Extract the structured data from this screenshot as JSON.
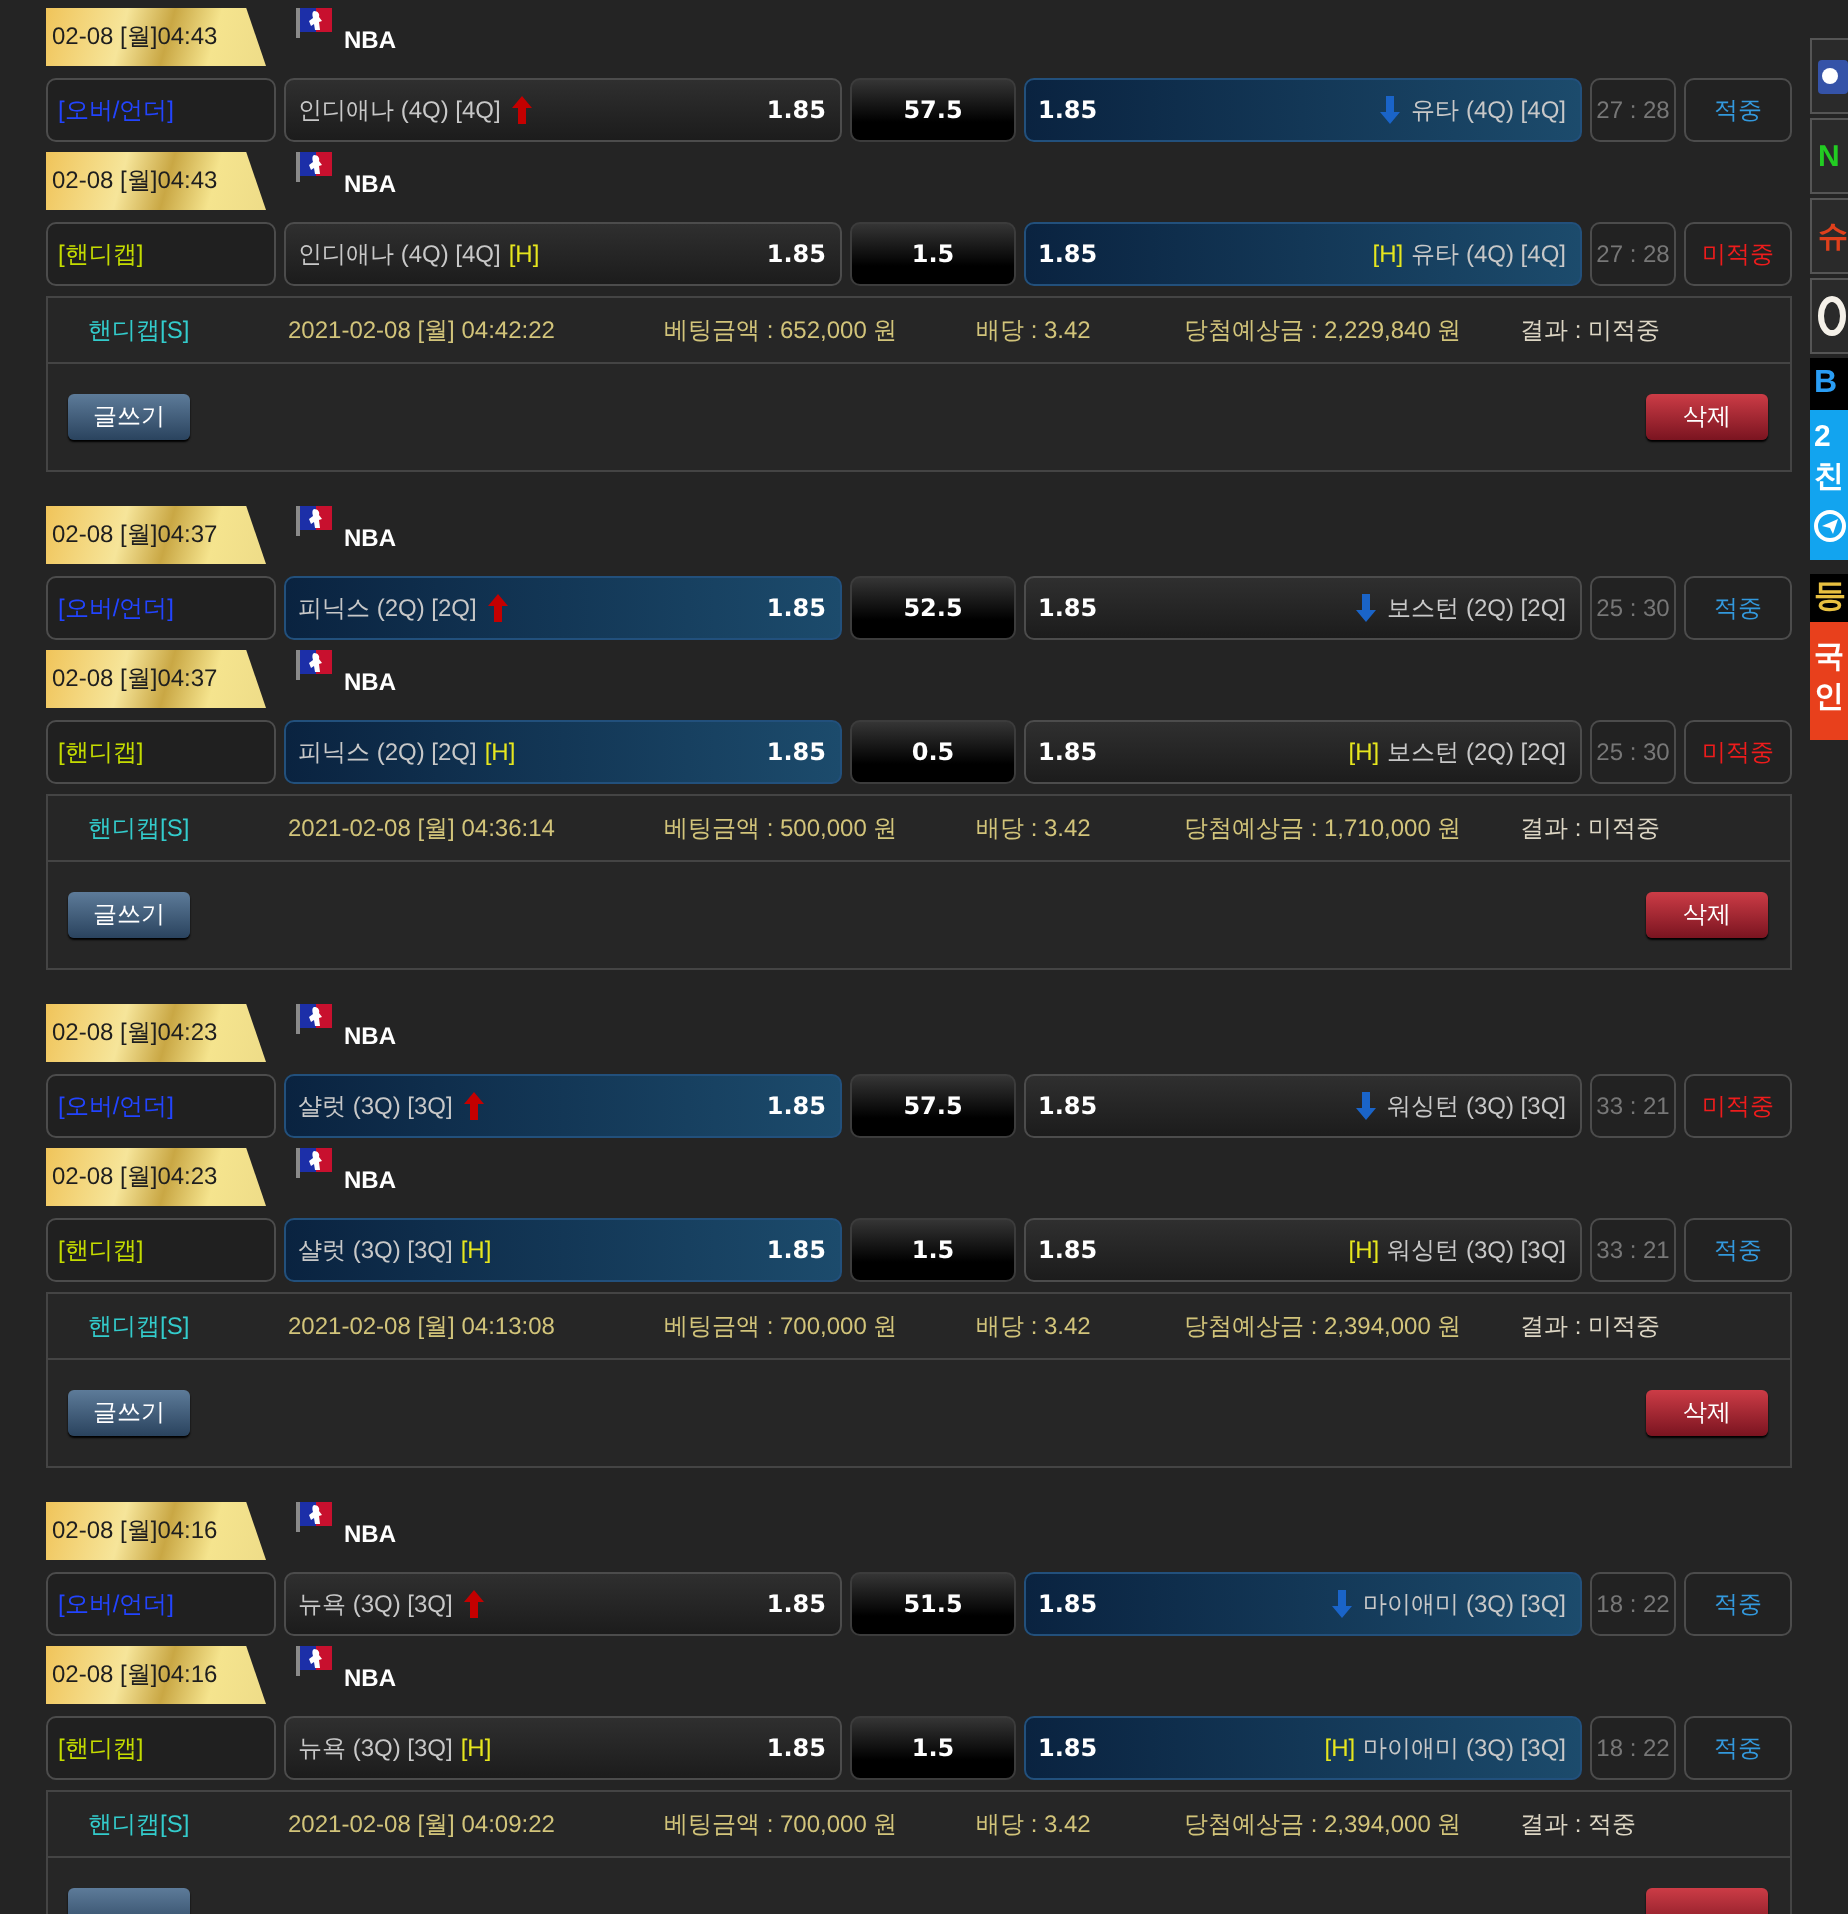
{
  "bets": [
    {
      "slips": [
        {
          "date": "02-08 [월]04:43",
          "league": "NBA",
          "kind": "over_under",
          "type_label": "[오버/언더]",
          "home": {
            "name": "인디애나 (4Q) [4Q]",
            "odds": "1.85",
            "selected": false
          },
          "line": "57.5",
          "away": {
            "name": "유타 (4Q) [4Q]",
            "odds": "1.85",
            "selected": true
          },
          "score": "27 : 28",
          "result": "적중",
          "hit": true
        },
        {
          "date": "02-08 [월]04:43",
          "league": "NBA",
          "kind": "handicap",
          "type_label": "[핸디캡]",
          "home": {
            "name": "인디애나 (4Q) [4Q]",
            "tag": "[H]",
            "odds": "1.85",
            "selected": false
          },
          "line": "1.5",
          "away": {
            "name": "유타 (4Q) [4Q]",
            "tag": "[H]",
            "odds": "1.85",
            "selected": true
          },
          "score": "27 : 28",
          "result": "미적중",
          "hit": false
        }
      ],
      "summary": {
        "type": "핸디캡[S]",
        "time": "2021-02-08 [월] 04:42:22",
        "amount": "베팅금액 : 652,000 원",
        "odds": "배당 : 3.42",
        "payout": "당첨예상금 : 2,229,840 원",
        "result": "결과 : 미적중"
      },
      "buttons": [
        {
          "kind": "write",
          "label": "글쓰기"
        },
        {
          "kind": "delete",
          "label": "삭제"
        }
      ]
    },
    {
      "slips": [
        {
          "date": "02-08 [월]04:37",
          "league": "NBA",
          "kind": "over_under",
          "type_label": "[오버/언더]",
          "home": {
            "name": "피닉스 (2Q) [2Q]",
            "odds": "1.85",
            "selected": true
          },
          "line": "52.5",
          "away": {
            "name": "보스턴 (2Q) [2Q]",
            "odds": "1.85",
            "selected": false
          },
          "score": "25 : 30",
          "result": "적중",
          "hit": true
        },
        {
          "date": "02-08 [월]04:37",
          "league": "NBA",
          "kind": "handicap",
          "type_label": "[핸디캡]",
          "home": {
            "name": "피닉스 (2Q) [2Q]",
            "tag": "[H]",
            "odds": "1.85",
            "selected": true
          },
          "line": "0.5",
          "away": {
            "name": "보스턴 (2Q) [2Q]",
            "tag": "[H]",
            "odds": "1.85",
            "selected": false
          },
          "score": "25 : 30",
          "result": "미적중",
          "hit": false
        }
      ],
      "summary": {
        "type": "핸디캡[S]",
        "time": "2021-02-08 [월] 04:36:14",
        "amount": "베팅금액 : 500,000 원",
        "odds": "배당 : 3.42",
        "payout": "당첨예상금 : 1,710,000 원",
        "result": "결과 : 미적중"
      },
      "buttons": [
        {
          "kind": "write",
          "label": "글쓰기"
        },
        {
          "kind": "delete",
          "label": "삭제"
        }
      ]
    },
    {
      "slips": [
        {
          "date": "02-08 [월]04:23",
          "league": "NBA",
          "kind": "over_under",
          "type_label": "[오버/언더]",
          "home": {
            "name": "샬럿 (3Q) [3Q]",
            "odds": "1.85",
            "selected": true
          },
          "line": "57.5",
          "away": {
            "name": "워싱턴 (3Q) [3Q]",
            "odds": "1.85",
            "selected": false
          },
          "score": "33 : 21",
          "result": "미적중",
          "hit": false
        },
        {
          "date": "02-08 [월]04:23",
          "league": "NBA",
          "kind": "handicap",
          "type_label": "[핸디캡]",
          "home": {
            "name": "샬럿 (3Q) [3Q]",
            "tag": "[H]",
            "odds": "1.85",
            "selected": true
          },
          "line": "1.5",
          "away": {
            "name": "워싱턴 (3Q) [3Q]",
            "tag": "[H]",
            "odds": "1.85",
            "selected": false
          },
          "score": "33 : 21",
          "result": "적중",
          "hit": true
        }
      ],
      "summary": {
        "type": "핸디캡[S]",
        "time": "2021-02-08 [월] 04:13:08",
        "amount": "베팅금액 : 700,000 원",
        "odds": "배당 : 3.42",
        "payout": "당첨예상금 : 2,394,000 원",
        "result": "결과 : 미적중"
      },
      "buttons": [
        {
          "kind": "write",
          "label": "글쓰기"
        },
        {
          "kind": "delete",
          "label": "삭제"
        }
      ]
    },
    {
      "slips": [
        {
          "date": "02-08 [월]04:16",
          "league": "NBA",
          "kind": "over_under",
          "type_label": "[오버/언더]",
          "home": {
            "name": "뉴욕 (3Q) [3Q]",
            "odds": "1.85",
            "selected": false
          },
          "line": "51.5",
          "away": {
            "name": "마이애미 (3Q) [3Q]",
            "odds": "1.85",
            "selected": true
          },
          "score": "18 : 22",
          "result": "적중",
          "hit": true
        },
        {
          "date": "02-08 [월]04:16",
          "league": "NBA",
          "kind": "handicap",
          "type_label": "[핸디캡]",
          "home": {
            "name": "뉴욕 (3Q) [3Q]",
            "tag": "[H]",
            "odds": "1.85",
            "selected": false
          },
          "line": "1.5",
          "away": {
            "name": "마이애미 (3Q) [3Q]",
            "tag": "[H]",
            "odds": "1.85",
            "selected": true
          },
          "score": "18 : 22",
          "result": "적중",
          "hit": true
        }
      ],
      "summary": {
        "type": "핸디캡[S]",
        "time": "2021-02-08 [월] 04:09:22",
        "amount": "베팅금액 : 700,000 원",
        "odds": "배당 : 3.42",
        "payout": "당첨예상금 : 2,394,000 원",
        "result": "결과 : 적중"
      },
      "buttons": [
        {
          "kind": "write"
        },
        {
          "kind": "delete"
        }
      ]
    }
  ],
  "side_banners": [
    {
      "kind": "toggle"
    },
    {
      "kind": "letter",
      "text": "N",
      "color": "#22cc22"
    },
    {
      "kind": "letter",
      "text": "슈",
      "color": "#e0401c"
    },
    {
      "kind": "ring"
    },
    {
      "kind": "messenger",
      "title": "B",
      "lines": [
        "2",
        "친"
      ]
    },
    {
      "kind": "notice",
      "title": "등",
      "lines": [
        "국",
        "인"
      ]
    }
  ]
}
